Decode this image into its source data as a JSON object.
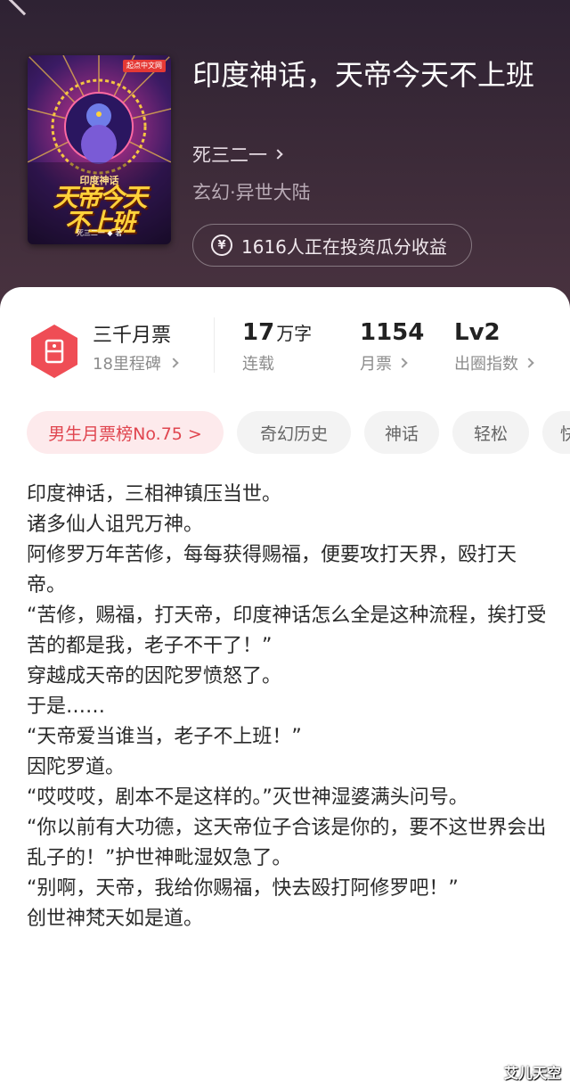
{
  "book": {
    "title": "印度神话，天帝今天不上班",
    "author": "死三二一",
    "genre": "玄幻·异世大陆",
    "invest_text": "1616人正在投资瓜分收益"
  },
  "cover": {
    "publisher_badge": "起点中文网",
    "subtitle": "印度神话",
    "title_line1": "天帝今天",
    "title_line2": "不上班",
    "author": "死三二一 ◆ 著"
  },
  "stats": {
    "monthly_ticket": {
      "title": "三千月票",
      "sub": "18里程碑"
    },
    "words": {
      "value": "17",
      "unit": "万字",
      "label": "连载"
    },
    "tickets": {
      "value": "1154",
      "label": "月票"
    },
    "level": {
      "value": "Lv2",
      "label": "出圈指数"
    }
  },
  "tags": [
    "男生月票榜No.75 >",
    "奇幻历史",
    "神话",
    "轻松",
    "快"
  ],
  "description": [
    "印度神话，三相神镇压当世。",
    "诸多仙人诅咒万神。",
    "阿修罗万年苦修，每每获得赐福，便要攻打天界，殴打天帝。",
    "“苦修，赐福，打天帝，印度神话怎么全是这种流程，挨打受苦的都是我，老子不干了！”",
    "穿越成天帝的因陀罗愤怒了。",
    "于是……",
    "“天帝爱当谁当，老子不上班！”",
    "因陀罗道。",
    "“哎哎哎，剧本不是这样的。”灭世神湿婆满头问号。",
    "“你以前有大功德，这天帝位子合该是你的，要不这世界会出乱子的！”护世神毗湿奴急了。",
    "“别啊，天帝，我给你赐福，快去殴打阿修罗吧！”",
    "创世神梵天如是道。"
  ],
  "watermark": "艾儿天空",
  "colors": {
    "accent": "#e0454f",
    "header_bg": "#3b2a38"
  }
}
